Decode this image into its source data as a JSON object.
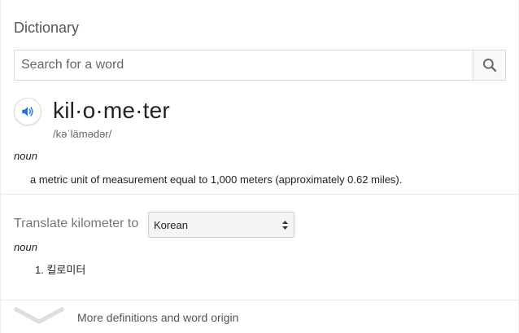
{
  "dictionary": {
    "title": "Dictionary",
    "search": {
      "placeholder": "Search for a word",
      "value": "",
      "button_icon": "search-icon"
    },
    "entry": {
      "headword": "kil·o·me·ter",
      "phonetic": "/kəˈlämədər/",
      "audio_icon": "speaker-icon",
      "part_of_speech": "noun",
      "definition": "a metric unit of measurement equal to 1,000 meters (approximately 0.62 miles)."
    },
    "translate": {
      "label": "Translate kilometer to",
      "selected_language": "Korean",
      "part_of_speech": "noun",
      "items": [
        {
          "number": "1.",
          "text": "킬로미터"
        }
      ]
    },
    "more": {
      "label": "More definitions and word origin",
      "icon": "chevron-down-icon"
    },
    "colors": {
      "accent": "#1a73e8",
      "text": "#222222",
      "muted": "#777777",
      "border": "#d9d9d9"
    }
  }
}
